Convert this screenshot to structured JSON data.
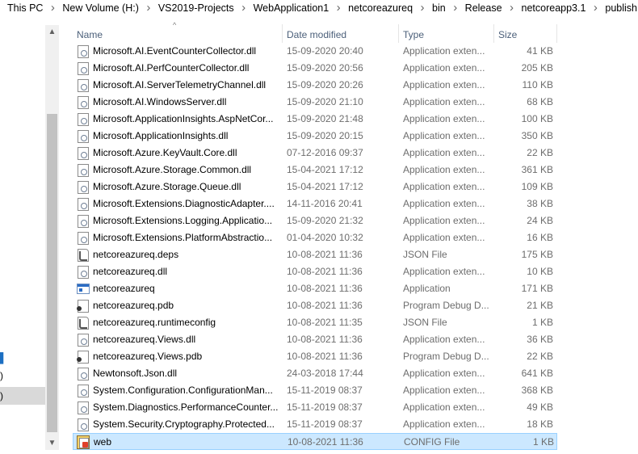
{
  "breadcrumb": [
    "This PC",
    "New Volume (H:)",
    "VS2019-Projects",
    "WebApplication1",
    "netcoreazureq",
    "bin",
    "Release",
    "netcoreapp3.1",
    "publish"
  ],
  "nav_fragments": [
    ")",
    ")"
  ],
  "columns": {
    "name": "Name",
    "date": "Date modified",
    "type": "Type",
    "size": "Size"
  },
  "icons": {
    "dll": "dll-file-icon",
    "json": "json-file-icon",
    "exe": "application-icon",
    "pdb": "pdb-file-icon",
    "config": "config-file-icon"
  },
  "files": [
    {
      "name": "Microsoft.AI.EventCounterCollector.dll",
      "date": "15-09-2020 20:40",
      "type": "Application exten...",
      "size": "41 KB",
      "icon": "dll"
    },
    {
      "name": "Microsoft.AI.PerfCounterCollector.dll",
      "date": "15-09-2020 20:56",
      "type": "Application exten...",
      "size": "205 KB",
      "icon": "dll"
    },
    {
      "name": "Microsoft.AI.ServerTelemetryChannel.dll",
      "date": "15-09-2020 20:26",
      "type": "Application exten...",
      "size": "110 KB",
      "icon": "dll"
    },
    {
      "name": "Microsoft.AI.WindowsServer.dll",
      "date": "15-09-2020 21:10",
      "type": "Application exten...",
      "size": "68 KB",
      "icon": "dll"
    },
    {
      "name": "Microsoft.ApplicationInsights.AspNetCor...",
      "date": "15-09-2020 21:48",
      "type": "Application exten...",
      "size": "100 KB",
      "icon": "dll"
    },
    {
      "name": "Microsoft.ApplicationInsights.dll",
      "date": "15-09-2020 20:15",
      "type": "Application exten...",
      "size": "350 KB",
      "icon": "dll"
    },
    {
      "name": "Microsoft.Azure.KeyVault.Core.dll",
      "date": "07-12-2016 09:37",
      "type": "Application exten...",
      "size": "22 KB",
      "icon": "dll"
    },
    {
      "name": "Microsoft.Azure.Storage.Common.dll",
      "date": "15-04-2021 17:12",
      "type": "Application exten...",
      "size": "361 KB",
      "icon": "dll"
    },
    {
      "name": "Microsoft.Azure.Storage.Queue.dll",
      "date": "15-04-2021 17:12",
      "type": "Application exten...",
      "size": "109 KB",
      "icon": "dll"
    },
    {
      "name": "Microsoft.Extensions.DiagnosticAdapter....",
      "date": "14-11-2016 20:41",
      "type": "Application exten...",
      "size": "38 KB",
      "icon": "dll"
    },
    {
      "name": "Microsoft.Extensions.Logging.Applicatio...",
      "date": "15-09-2020 21:32",
      "type": "Application exten...",
      "size": "24 KB",
      "icon": "dll"
    },
    {
      "name": "Microsoft.Extensions.PlatformAbstractio...",
      "date": "01-04-2020 10:32",
      "type": "Application exten...",
      "size": "16 KB",
      "icon": "dll"
    },
    {
      "name": "netcoreazureq.deps",
      "date": "10-08-2021 11:36",
      "type": "JSON File",
      "size": "175 KB",
      "icon": "json"
    },
    {
      "name": "netcoreazureq.dll",
      "date": "10-08-2021 11:36",
      "type": "Application exten...",
      "size": "10 KB",
      "icon": "dll"
    },
    {
      "name": "netcoreazureq",
      "date": "10-08-2021 11:36",
      "type": "Application",
      "size": "171 KB",
      "icon": "exe"
    },
    {
      "name": "netcoreazureq.pdb",
      "date": "10-08-2021 11:36",
      "type": "Program Debug D...",
      "size": "21 KB",
      "icon": "pdb"
    },
    {
      "name": "netcoreazureq.runtimeconfig",
      "date": "10-08-2021 11:35",
      "type": "JSON File",
      "size": "1 KB",
      "icon": "json"
    },
    {
      "name": "netcoreazureq.Views.dll",
      "date": "10-08-2021 11:36",
      "type": "Application exten...",
      "size": "36 KB",
      "icon": "dll"
    },
    {
      "name": "netcoreazureq.Views.pdb",
      "date": "10-08-2021 11:36",
      "type": "Program Debug D...",
      "size": "22 KB",
      "icon": "pdb"
    },
    {
      "name": "Newtonsoft.Json.dll",
      "date": "24-03-2018 17:44",
      "type": "Application exten...",
      "size": "641 KB",
      "icon": "dll"
    },
    {
      "name": "System.Configuration.ConfigurationMan...",
      "date": "15-11-2019 08:37",
      "type": "Application exten...",
      "size": "368 KB",
      "icon": "dll"
    },
    {
      "name": "System.Diagnostics.PerformanceCounter...",
      "date": "15-11-2019 08:37",
      "type": "Application exten...",
      "size": "49 KB",
      "icon": "dll"
    },
    {
      "name": "System.Security.Cryptography.Protected...",
      "date": "15-11-2019 08:37",
      "type": "Application exten...",
      "size": "18 KB",
      "icon": "dll"
    },
    {
      "name": "web",
      "date": "10-08-2021 11:36",
      "type": "CONFIG File",
      "size": "1 KB",
      "icon": "config",
      "selected": true
    }
  ]
}
